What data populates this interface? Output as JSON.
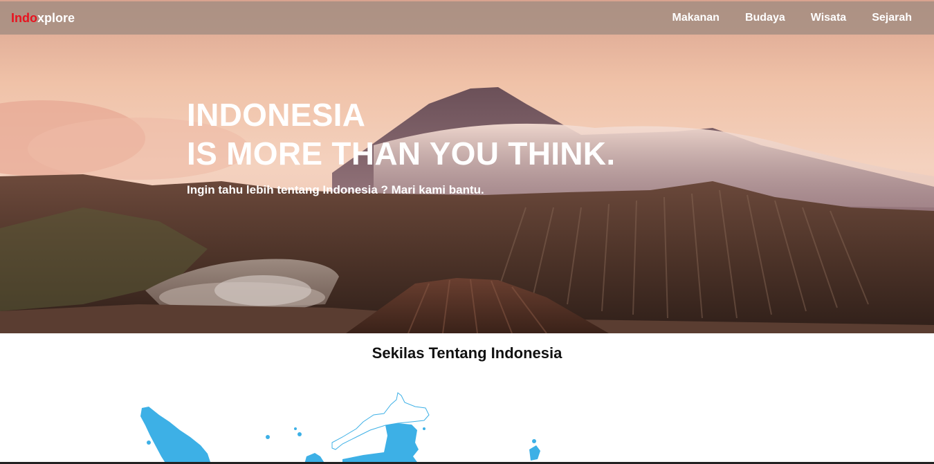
{
  "brand": {
    "accent": "Indo",
    "rest": "xplore",
    "accent_color": "#e8131f"
  },
  "nav": {
    "items": [
      {
        "label": "Makanan"
      },
      {
        "label": "Budaya"
      },
      {
        "label": "Wisata"
      },
      {
        "label": "Sejarah"
      }
    ]
  },
  "hero": {
    "title_line1": "INDONESIA",
    "title_line2": "IS MORE THAN YOU THINK.",
    "subtitle": "Ingin tahu lebih tentang Indonesia ? Mari kami bantu."
  },
  "section": {
    "title": "Sekilas Tentang Indonesia",
    "map_color": "#3db0e6"
  }
}
